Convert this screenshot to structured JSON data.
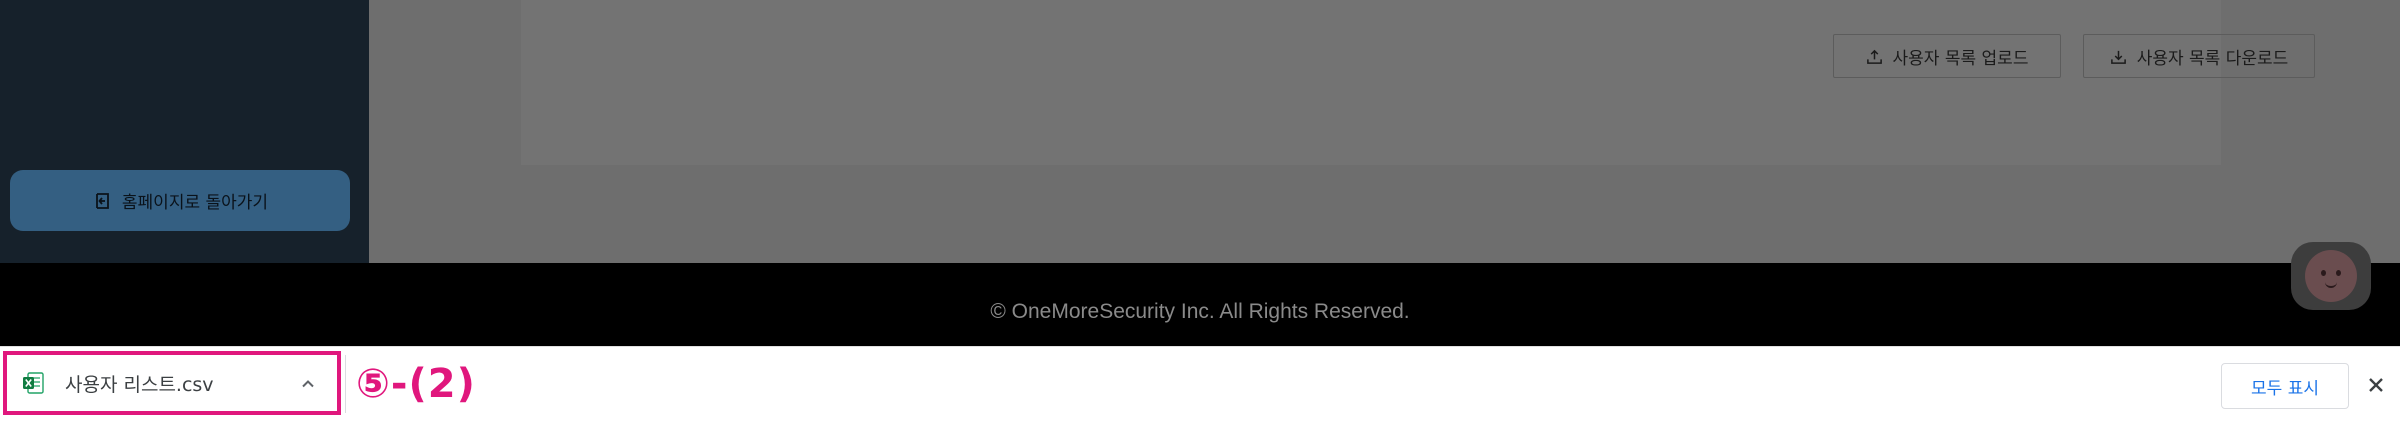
{
  "sidebar": {
    "home_button_label": "홈페이지로 돌아가기"
  },
  "main": {
    "upload_button_label": "사용자 목록 업로드",
    "download_button_label": "사용자 목록 다운로드"
  },
  "footer": {
    "copyright": "© OneMoreSecurity Inc. All Rights Reserved."
  },
  "download_bar": {
    "file_name": "사용자 리스트.csv",
    "annotation": "⑤-(2)",
    "show_all_label": "모두 표시"
  },
  "colors": {
    "annotation_accent": "#e0177d",
    "link_blue": "#1a73e8",
    "sidebar_bg": "#16212b",
    "home_button_bg": "#345f82"
  },
  "icons": {
    "home_button": "exit-to-home-icon",
    "upload": "upload-icon",
    "download": "download-icon",
    "file": "excel-csv-file-icon",
    "expand": "chevron-up-icon",
    "close": "close-icon",
    "chat": "chatbot-icon"
  }
}
